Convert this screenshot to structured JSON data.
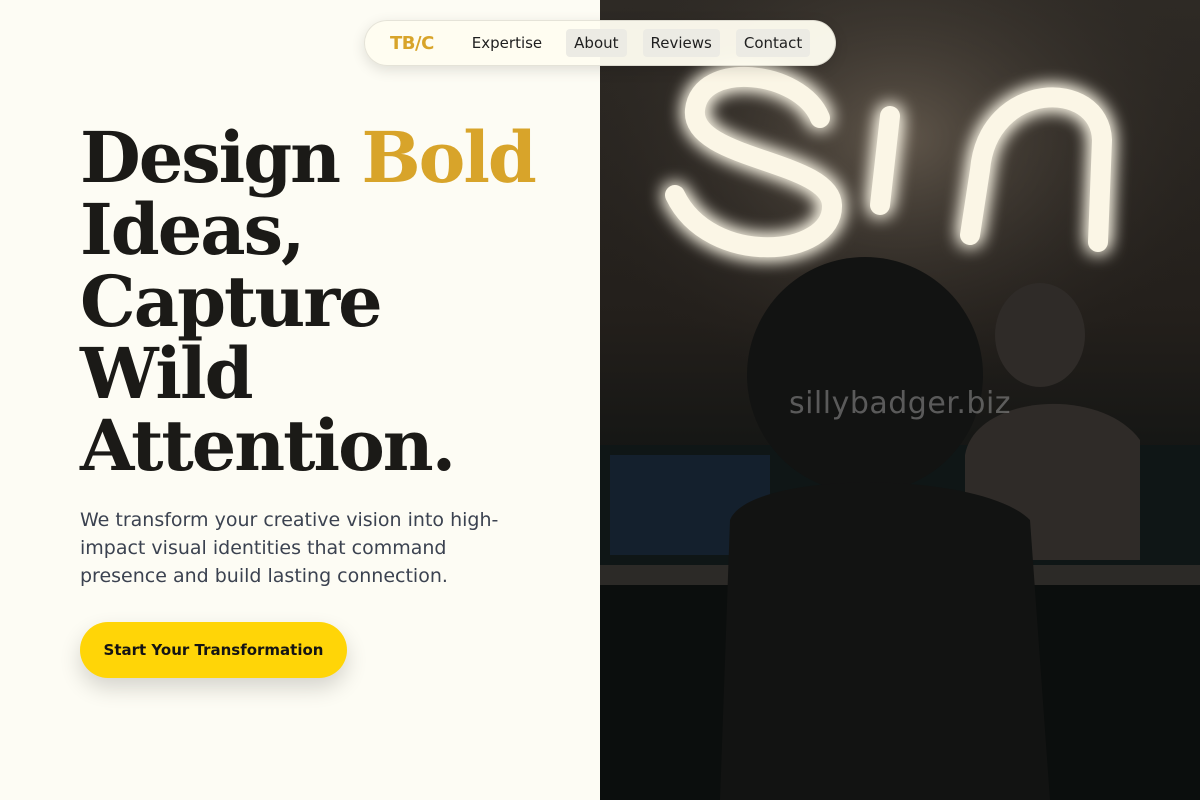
{
  "nav": {
    "logo": "TB/C",
    "links": [
      {
        "label": "Expertise"
      },
      {
        "label": "About"
      },
      {
        "label": "Reviews"
      },
      {
        "label": "Contact"
      }
    ]
  },
  "hero": {
    "headline": {
      "line1_part1": "Design",
      "line1_accent": "Bold",
      "line2": "Ideas,",
      "line3": "Capture",
      "line4": "Wild",
      "line5": "Attention."
    },
    "subtext": "We transform your creative vision into high-impact visual identities that command presence and build lasting connection.",
    "cta_label": "Start Your Transformation"
  },
  "photo": {
    "neon_sign_text": "Sin",
    "watermark": "sillybadger.biz"
  },
  "colors": {
    "accent": "#d8a42a",
    "cta": "#ffd507",
    "background": "#fdfcf4",
    "headline": "#1b1a17"
  }
}
